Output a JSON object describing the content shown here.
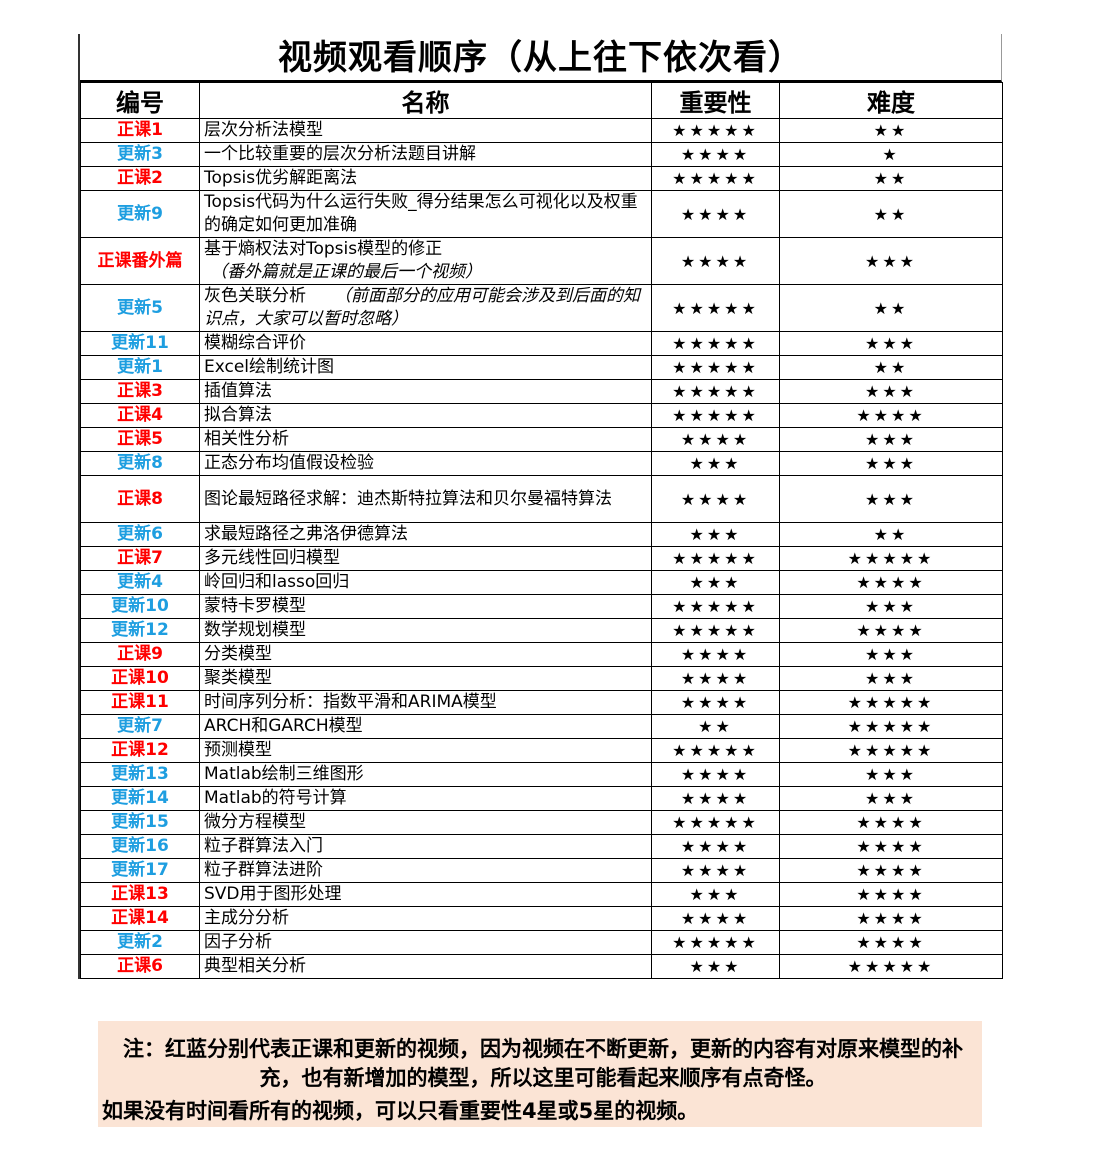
{
  "title": "视频观看顺序（从上往下依次看）",
  "headers": {
    "code": "编号",
    "name": "名称",
    "importance": "重要性",
    "difficulty": "难度"
  },
  "colors": {
    "lesson": "#ff0000",
    "update": "#1e9ee0",
    "note_bg": "#fbe4d5"
  },
  "rows": [
    {
      "code": "正课1",
      "kind": "lesson",
      "name": "层次分析法模型",
      "name_note": "",
      "importance": 5,
      "difficulty": 2,
      "lines": 1
    },
    {
      "code": "更新3",
      "kind": "update",
      "name": "一个比较重要的层次分析法题目讲解",
      "name_note": "",
      "importance": 4,
      "difficulty": 1,
      "lines": 1
    },
    {
      "code": "正课2",
      "kind": "lesson",
      "name": "Topsis优劣解距离法",
      "name_note": "",
      "importance": 5,
      "difficulty": 2,
      "lines": 1
    },
    {
      "code": "更新9",
      "kind": "update",
      "name": "Topsis代码为什么运行失败_得分结果怎么可视化以及权重的确定如何更加准确",
      "name_note": "",
      "importance": 4,
      "difficulty": 2,
      "lines": 2
    },
    {
      "code": "正课番外篇",
      "kind": "lesson",
      "name": "基于熵权法对Topsis模型的修正",
      "name_note": "（番外篇就是正课的最后一个视频）",
      "importance": 4,
      "difficulty": 3,
      "lines": 2
    },
    {
      "code": "更新5",
      "kind": "update",
      "name": "灰色关联分析",
      "name_note": "（前面部分的应用可能会涉及到后面的知识点，大家可以暂时忽略）",
      "importance": 5,
      "difficulty": 2,
      "lines": 2
    },
    {
      "code": "更新11",
      "kind": "update",
      "name": "模糊综合评价",
      "name_note": "",
      "importance": 5,
      "difficulty": 3,
      "lines": 1
    },
    {
      "code": "更新1",
      "kind": "update",
      "name": "Excel绘制统计图",
      "name_note": "",
      "importance": 5,
      "difficulty": 2,
      "lines": 1
    },
    {
      "code": "正课3",
      "kind": "lesson",
      "name": "插值算法",
      "name_note": "",
      "importance": 5,
      "difficulty": 3,
      "lines": 1
    },
    {
      "code": "正课4",
      "kind": "lesson",
      "name": "拟合算法",
      "name_note": "",
      "importance": 5,
      "difficulty": 4,
      "lines": 1
    },
    {
      "code": "正课5",
      "kind": "lesson",
      "name": "相关性分析",
      "name_note": "",
      "importance": 4,
      "difficulty": 3,
      "lines": 1
    },
    {
      "code": "更新8",
      "kind": "update",
      "name": "正态分布均值假设检验",
      "name_note": "",
      "importance": 3,
      "difficulty": 3,
      "lines": 1
    },
    {
      "code": "正课8",
      "kind": "lesson",
      "name": "图论最短路径求解：迪杰斯特拉算法和贝尔曼福特算法",
      "name_note": "",
      "importance": 4,
      "difficulty": 3,
      "lines": 2
    },
    {
      "code": "更新6",
      "kind": "update",
      "name": "求最短路径之弗洛伊德算法",
      "name_note": "",
      "importance": 3,
      "difficulty": 2,
      "lines": 1
    },
    {
      "code": "正课7",
      "kind": "lesson",
      "name": "多元线性回归模型",
      "name_note": "",
      "importance": 5,
      "difficulty": 5,
      "lines": 1
    },
    {
      "code": "更新4",
      "kind": "update",
      "name": "岭回归和lasso回归",
      "name_note": "",
      "importance": 3,
      "difficulty": 4,
      "lines": 1
    },
    {
      "code": "更新10",
      "kind": "update",
      "name": "蒙特卡罗模型",
      "name_note": "",
      "importance": 5,
      "difficulty": 3,
      "lines": 1
    },
    {
      "code": "更新12",
      "kind": "update",
      "name": "数学规划模型",
      "name_note": "",
      "importance": 5,
      "difficulty": 4,
      "lines": 1
    },
    {
      "code": "正课9",
      "kind": "lesson",
      "name": "分类模型",
      "name_note": "",
      "importance": 4,
      "difficulty": 3,
      "lines": 1
    },
    {
      "code": "正课10",
      "kind": "lesson",
      "name": "聚类模型",
      "name_note": "",
      "importance": 4,
      "difficulty": 3,
      "lines": 1
    },
    {
      "code": "正课11",
      "kind": "lesson",
      "name": "时间序列分析：指数平滑和ARIMA模型",
      "name_note": "",
      "importance": 4,
      "difficulty": 5,
      "lines": 1
    },
    {
      "code": "更新7",
      "kind": "update",
      "name": "ARCH和GARCH模型",
      "name_note": "",
      "importance": 2,
      "difficulty": 5,
      "lines": 1
    },
    {
      "code": "正课12",
      "kind": "lesson",
      "name": "预测模型",
      "name_note": "",
      "importance": 5,
      "difficulty": 5,
      "lines": 1
    },
    {
      "code": "更新13",
      "kind": "update",
      "name": "Matlab绘制三维图形",
      "name_note": "",
      "importance": 4,
      "difficulty": 3,
      "lines": 1
    },
    {
      "code": "更新14",
      "kind": "update",
      "name": "Matlab的符号计算",
      "name_note": "",
      "importance": 4,
      "difficulty": 3,
      "lines": 1
    },
    {
      "code": "更新15",
      "kind": "update",
      "name": "微分方程模型",
      "name_note": "",
      "importance": 5,
      "difficulty": 4,
      "lines": 1
    },
    {
      "code": "更新16",
      "kind": "update",
      "name": "粒子群算法入门",
      "name_note": "",
      "importance": 4,
      "difficulty": 4,
      "lines": 1
    },
    {
      "code": "更新17",
      "kind": "update",
      "name": "粒子群算法进阶",
      "name_note": "",
      "importance": 4,
      "difficulty": 4,
      "lines": 1
    },
    {
      "code": "正课13",
      "kind": "lesson",
      "name": "SVD用于图形处理",
      "name_note": "",
      "importance": 3,
      "difficulty": 4,
      "lines": 1
    },
    {
      "code": "正课14",
      "kind": "lesson",
      "name": "主成分分析",
      "name_note": "",
      "importance": 4,
      "difficulty": 4,
      "lines": 1
    },
    {
      "code": "更新2",
      "kind": "update",
      "name": "因子分析",
      "name_note": "",
      "importance": 5,
      "difficulty": 4,
      "lines": 1
    },
    {
      "code": "正课6",
      "kind": "lesson",
      "name": "典型相关分析",
      "name_note": "",
      "importance": 3,
      "difficulty": 5,
      "lines": 1
    }
  ],
  "note": {
    "line1": "注：红蓝分别代表正课和更新的视频，因为视频在不断更新，更新的内容有对原来模型的补充，也有新增加的模型，所以这里可能看起来顺序有点奇怪。",
    "line2": "如果没有时间看所有的视频，可以只看重要性4星或5星的视频。"
  }
}
